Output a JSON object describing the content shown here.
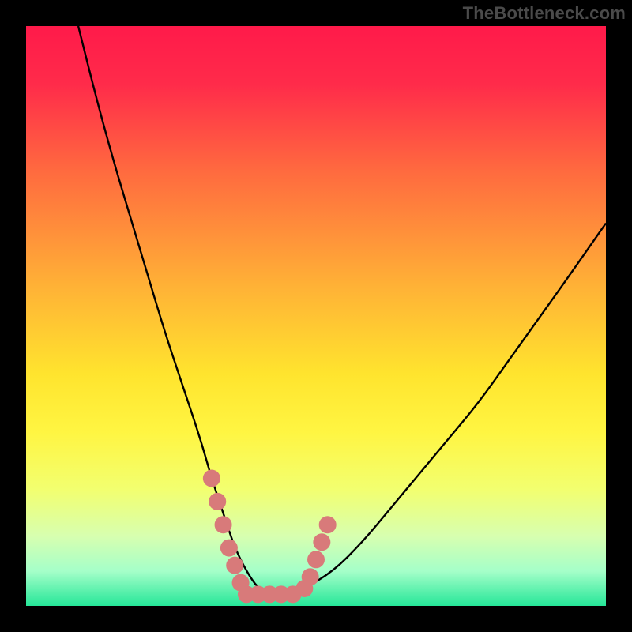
{
  "watermark": "TheBottleneck.com",
  "colors": {
    "frame": "#000000",
    "gradient_stops": [
      {
        "offset": 0.0,
        "color": "#ff1a4a"
      },
      {
        "offset": 0.1,
        "color": "#ff2b4a"
      },
      {
        "offset": 0.25,
        "color": "#ff6a3f"
      },
      {
        "offset": 0.45,
        "color": "#ffb236"
      },
      {
        "offset": 0.6,
        "color": "#ffe42e"
      },
      {
        "offset": 0.7,
        "color": "#fff542"
      },
      {
        "offset": 0.8,
        "color": "#f2ff70"
      },
      {
        "offset": 0.88,
        "color": "#d7ffb0"
      },
      {
        "offset": 0.94,
        "color": "#a5ffc9"
      },
      {
        "offset": 1.0,
        "color": "#25e698"
      }
    ],
    "curve": "#000000",
    "marker_fill": "#d87a7a",
    "marker_stroke": "#d87a7a"
  },
  "chart_data": {
    "type": "line",
    "title": "",
    "xlabel": "",
    "ylabel": "",
    "xlim": [
      0,
      100
    ],
    "ylim": [
      0,
      100
    ],
    "grid": false,
    "series": [
      {
        "name": "bottleneck-curve",
        "x": [
          9,
          12,
          15,
          18,
          21,
          24,
          27,
          30,
          32,
          34,
          36,
          38,
          40,
          42,
          45,
          48,
          53,
          58,
          63,
          68,
          73,
          78,
          83,
          88,
          93,
          100
        ],
        "y": [
          100,
          88,
          77,
          67,
          57,
          47,
          38,
          29,
          22,
          16,
          10,
          6,
          3,
          2,
          2,
          3,
          6,
          11,
          17,
          23,
          29,
          35,
          42,
          49,
          56,
          66
        ]
      }
    ],
    "markers": [
      {
        "x": 32,
        "y": 22
      },
      {
        "x": 33,
        "y": 18
      },
      {
        "x": 34,
        "y": 14
      },
      {
        "x": 35,
        "y": 10
      },
      {
        "x": 36,
        "y": 7
      },
      {
        "x": 37,
        "y": 4
      },
      {
        "x": 38,
        "y": 2
      },
      {
        "x": 40,
        "y": 2
      },
      {
        "x": 42,
        "y": 2
      },
      {
        "x": 44,
        "y": 2
      },
      {
        "x": 46,
        "y": 2
      },
      {
        "x": 48,
        "y": 3
      },
      {
        "x": 49,
        "y": 5
      },
      {
        "x": 50,
        "y": 8
      },
      {
        "x": 51,
        "y": 11
      },
      {
        "x": 52,
        "y": 14
      }
    ]
  }
}
